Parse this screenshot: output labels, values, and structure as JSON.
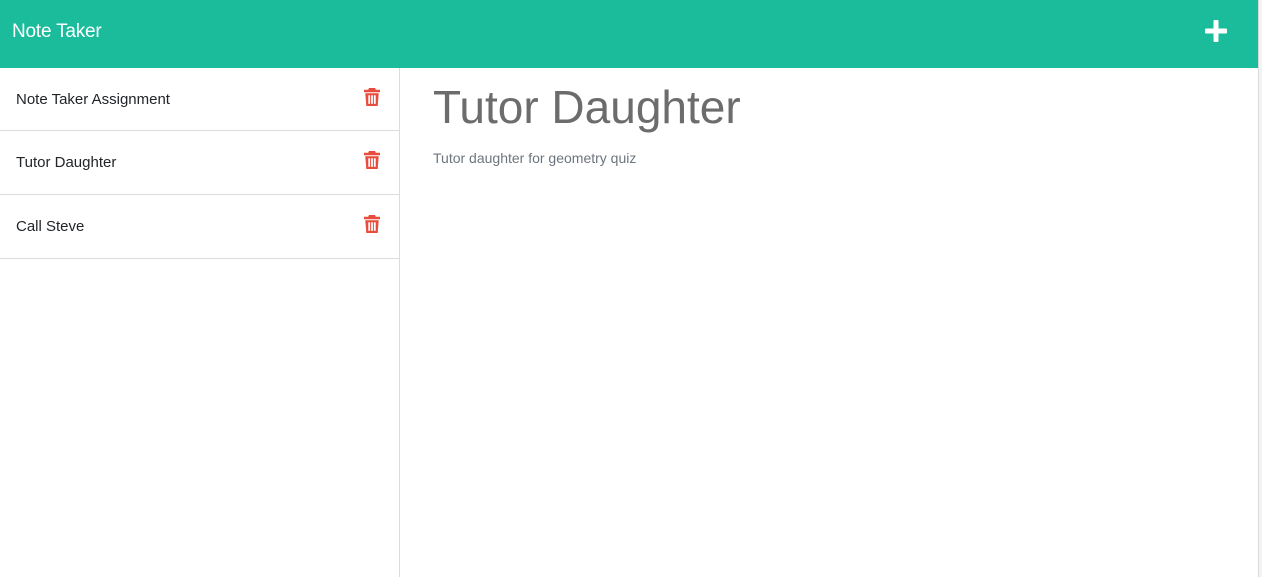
{
  "app": {
    "title": "Note Taker",
    "accent_color": "#1abc9c",
    "new_note_icon": "plus-icon"
  },
  "sidebar": {
    "notes": [
      {
        "title": "Note Taker Assignment",
        "delete_icon": "trash-icon"
      },
      {
        "title": "Tutor Daughter",
        "delete_icon": "trash-icon"
      },
      {
        "title": "Call Steve",
        "delete_icon": "trash-icon"
      }
    ],
    "delete_icon_color": "#e74c3c"
  },
  "editor": {
    "title": "Tutor Daughter",
    "text": "Tutor daughter for geometry quiz"
  }
}
